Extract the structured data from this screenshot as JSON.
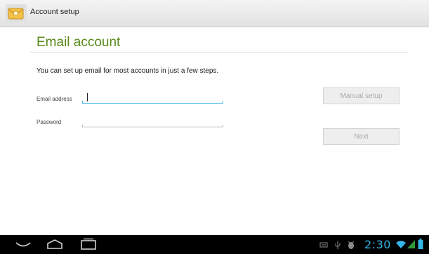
{
  "action_bar": {
    "title": "Account setup",
    "icon": "email-app-icon"
  },
  "page": {
    "title": "Email account",
    "intro": "You can set up email for most accounts in just a few steps."
  },
  "form": {
    "email_label": "Email address",
    "email_value": "",
    "password_label": "Password",
    "password_value": ""
  },
  "buttons": {
    "manual_setup": "Manual setup",
    "next": "Next"
  },
  "system_bar": {
    "time": "2:30",
    "icons": [
      "back-icon",
      "home-icon",
      "recent-apps-icon",
      "keyboard-icon",
      "usb-icon",
      "debug-icon",
      "wifi-icon",
      "signal-icon",
      "battery-icon"
    ]
  },
  "colors": {
    "title_green": "#5a8a1a",
    "accent_blue": "#33b5e5"
  }
}
